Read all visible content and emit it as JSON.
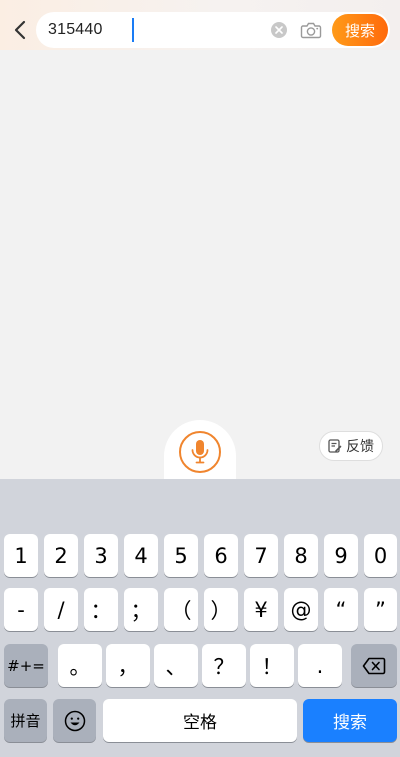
{
  "search": {
    "query": "315440",
    "button_label": "搜索"
  },
  "feedback": {
    "label": "反馈"
  },
  "keyboard": {
    "row1": [
      "1",
      "2",
      "3",
      "4",
      "5",
      "6",
      "7",
      "8",
      "9",
      "0"
    ],
    "row2": [
      "-",
      "/",
      "：",
      "；",
      "（",
      "）",
      "¥",
      "@",
      "“",
      "”"
    ],
    "row3": {
      "symbols_label": "#+=",
      "keys": [
        "。",
        "，",
        "、",
        "？",
        "！",
        "."
      ]
    },
    "row4": {
      "pinyin_label": "拼音",
      "space_label": "空格",
      "search_label": "搜索"
    }
  },
  "colors": {
    "accent": "#ff7a10",
    "mic": "#f0852e",
    "keyboard_search": "#1a80ff"
  },
  "icons": {
    "back": "chevron-left-icon",
    "clear": "clear-circle-icon",
    "camera": "camera-icon",
    "mic": "microphone-icon",
    "feedback": "feedback-icon",
    "emoji": "emoji-icon",
    "delete": "backspace-icon"
  }
}
